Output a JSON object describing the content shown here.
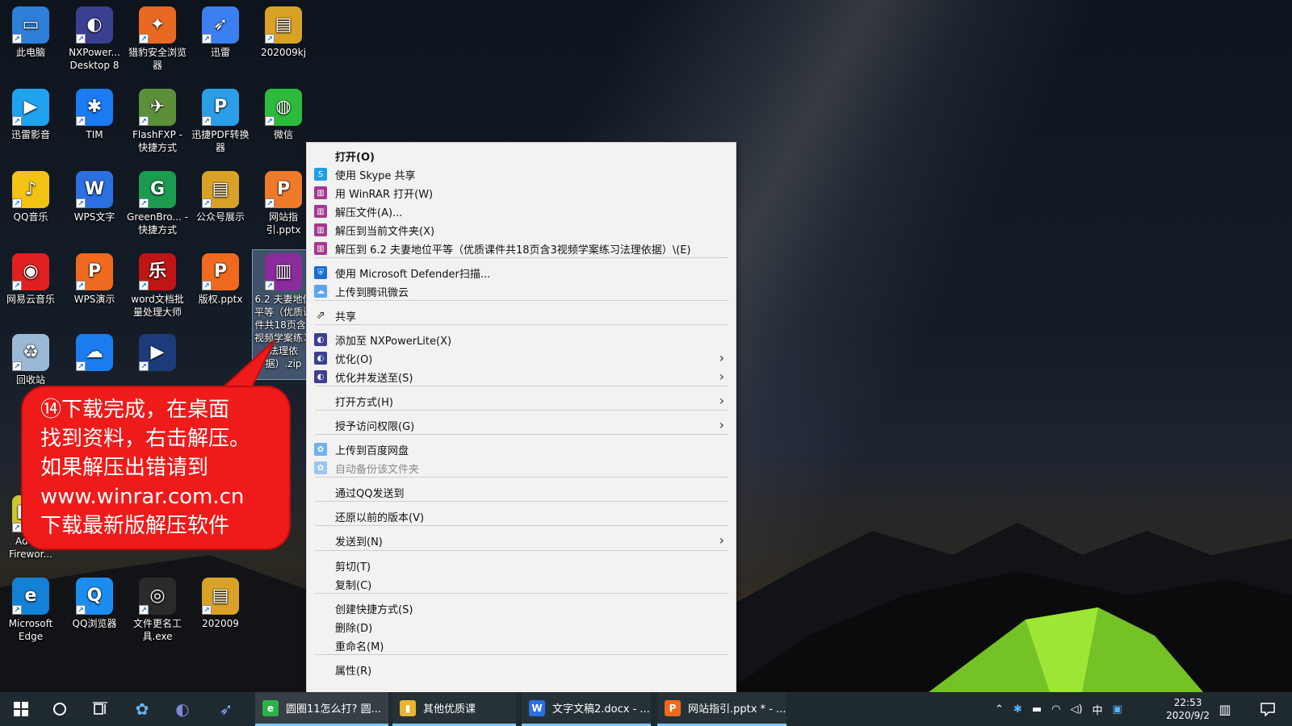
{
  "desktop": {
    "icons": [
      {
        "label": "此电脑",
        "color": "#2d7fd8",
        "glyph": "▭"
      },
      {
        "label": "NXPower... Desktop 8",
        "color": "#3b3f8f",
        "glyph": "◐"
      },
      {
        "label": "猎豹安全浏览器",
        "color": "#e86a22",
        "glyph": "✦"
      },
      {
        "label": "迅雷",
        "color": "#3c7ff0",
        "glyph": "➶"
      },
      {
        "label": "202009kj",
        "color": "#d9a227",
        "glyph": "▤"
      },
      {
        "label": "迅雷影音",
        "color": "#1fa3ef",
        "glyph": "▶"
      },
      {
        "label": "TIM",
        "color": "#1a7cf0",
        "glyph": "✱"
      },
      {
        "label": "FlashFXP - 快捷方式",
        "color": "#5b8f3a",
        "glyph": "✈"
      },
      {
        "label": "迅捷PDF转换器",
        "color": "#2a9ee8",
        "glyph": "P"
      },
      {
        "label": "微信",
        "color": "#2dbb3b",
        "glyph": "◍"
      },
      {
        "label": "QQ音乐",
        "color": "#f2c313",
        "glyph": "♪"
      },
      {
        "label": "WPS文字",
        "color": "#2b6fe2",
        "glyph": "W"
      },
      {
        "label": "GreenBro... - 快捷方式",
        "color": "#1b9b4f",
        "glyph": "G"
      },
      {
        "label": "公众号展示",
        "color": "#d9a227",
        "glyph": "▤"
      },
      {
        "label": "网站指引.pptx",
        "color": "#ef7a2a",
        "glyph": "P"
      },
      {
        "label": "网易云音乐",
        "color": "#e02020",
        "glyph": "◉"
      },
      {
        "label": "WPS演示",
        "color": "#ef6a1f",
        "glyph": "P"
      },
      {
        "label": "word文档批量处理大师",
        "color": "#c01515",
        "glyph": "乐"
      },
      {
        "label": "版权.pptx",
        "color": "#ef6a1f",
        "glyph": "P"
      },
      {
        "label": "6.2 夫妻地位平等（优质课件共18页含3视频学案练习法理依据）.zip",
        "color": "#8b2c9c",
        "glyph": "▥"
      },
      {
        "label": "回收站",
        "color": "#9bb9d6",
        "glyph": "♻"
      },
      {
        "label": "",
        "color": "#1a7cf0",
        "glyph": "☁"
      },
      {
        "label": "",
        "color": "#1b3b7a",
        "glyph": "▶"
      },
      {
        "label": "Adobe Firewor...",
        "color": "#c8c830",
        "glyph": "Fw"
      },
      {
        "label": "Microsoft Edge",
        "color": "#1381d6",
        "glyph": "e"
      },
      {
        "label": "QQ浏览器",
        "color": "#1b8df0",
        "glyph": "Q"
      },
      {
        "label": "文件更名工具.exe",
        "color": "#2a2a2a",
        "glyph": "◎"
      },
      {
        "label": "202009",
        "color": "#d9a227",
        "glyph": "▤"
      }
    ]
  },
  "context_menu": {
    "items": [
      {
        "label": "打开(O)",
        "bold": true,
        "icon": "",
        "icon_color": ""
      },
      {
        "label": "使用 Skype 共享",
        "icon": "skype-icon",
        "icon_color": "#1ea0e8",
        "glyph": "S"
      },
      {
        "label": "用 WinRAR 打开(W)",
        "icon": "winrar-icon",
        "icon_color": "#a43a8e",
        "glyph": "▥"
      },
      {
        "label": "解压文件(A)...",
        "icon": "winrar-icon",
        "icon_color": "#a43a8e",
        "glyph": "▥"
      },
      {
        "label": "解压到当前文件夹(X)",
        "icon": "winrar-icon",
        "icon_color": "#a43a8e",
        "glyph": "▥"
      },
      {
        "label": "解压到 6.2 夫妻地位平等（优质课件共18页含3视频学案练习法理依据）\\(E)",
        "icon": "winrar-icon",
        "icon_color": "#a43a8e",
        "glyph": "▥"
      },
      {
        "label": "使用 Microsoft Defender扫描...",
        "icon": "defender-icon",
        "icon_color": "#1a6fd0",
        "glyph": "⛨"
      },
      {
        "label": "上传到腾讯微云",
        "icon": "weiyun-icon",
        "icon_color": "#5aa7f0",
        "glyph": "☁"
      },
      {
        "label": "共享",
        "icon": "share-icon",
        "icon_color": "",
        "glyph": "⇗"
      },
      {
        "label": "添加至 NXPowerLite(X)",
        "icon": "nxpowerlite-icon",
        "icon_color": "#3b3f8f",
        "glyph": "◐"
      },
      {
        "label": "优化(O)",
        "icon": "nxpowerlite-icon",
        "icon_color": "#3b3f8f",
        "glyph": "◐",
        "submenu": true
      },
      {
        "label": "优化并发送至(S)",
        "icon": "nxpowerlite-icon",
        "icon_color": "#3b3f8f",
        "glyph": "◐",
        "submenu": true
      },
      {
        "label": "打开方式(H)",
        "submenu": true
      },
      {
        "label": "授予访问权限(G)",
        "submenu": true
      },
      {
        "label": "上传到百度网盘",
        "icon": "baidu-netdisk-icon",
        "icon_color": "#6fb2ee",
        "glyph": "✿"
      },
      {
        "label": "自动备份该文件夹",
        "icon": "baidu-netdisk-icon",
        "icon_color": "#9cc8f0",
        "glyph": "✿",
        "disabled": true
      },
      {
        "label": "通过QQ发送到"
      },
      {
        "label": "还原以前的版本(V)"
      },
      {
        "label": "发送到(N)",
        "submenu": true
      },
      {
        "label": "剪切(T)"
      },
      {
        "label": "复制(C)"
      },
      {
        "label": "创建快捷方式(S)"
      },
      {
        "label": "删除(D)"
      },
      {
        "label": "重命名(M)"
      },
      {
        "label": "属性(R)"
      }
    ]
  },
  "callout": {
    "lines": [
      "⑭下载完成，在桌面",
      "找到资料，右击解压。",
      "如果解压出错请到",
      "www.winrar.com.cn",
      "下载最新版解压软件"
    ]
  },
  "taskbar": {
    "apps": [
      {
        "label": "圆圈11怎么打? 圆...",
        "color": "#2bb34a",
        "glyph": "e"
      },
      {
        "label": "其他优质课",
        "color": "#e8b431",
        "glyph": "▮"
      },
      {
        "label": "文字文稿2.docx - ...",
        "color": "#2b6fe2",
        "glyph": "W"
      },
      {
        "label": "网站指引.pptx * - ...",
        "color": "#ef6a1f",
        "glyph": "P"
      }
    ],
    "clock": {
      "time": "22:53",
      "date": "2020/9/2"
    }
  }
}
